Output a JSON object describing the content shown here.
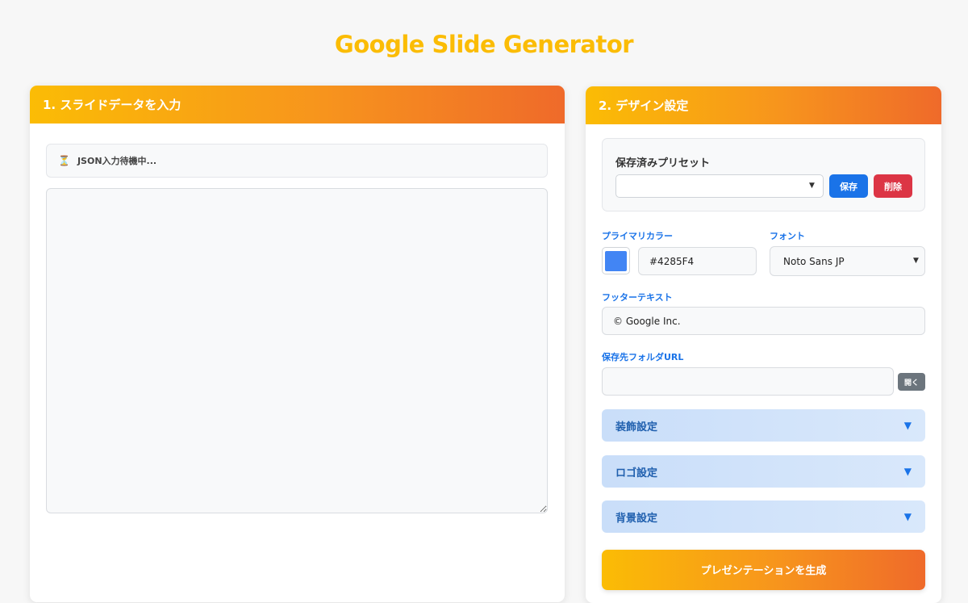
{
  "page": {
    "title": "Google Slide Generator"
  },
  "input_panel": {
    "header": "1. スライドデータを入力",
    "status_icon": "hourglass-icon",
    "status_text": "JSON入力待機中...",
    "textarea_value": ""
  },
  "design_panel": {
    "header": "2. デザイン設定",
    "presets": {
      "label": "保存済みプリセット",
      "selected": "",
      "save_label": "保存",
      "delete_label": "削除"
    },
    "primary_color": {
      "label": "プライマリカラー",
      "value": "#4285F4",
      "swatch": "#4285F4"
    },
    "font": {
      "label": "フォント",
      "selected": "Noto Sans JP"
    },
    "footer_text": {
      "label": "フッターテキスト",
      "value": "© Google Inc."
    },
    "folder_url": {
      "label": "保存先フォルダURL",
      "value": "",
      "open_label": "開く"
    },
    "sections": [
      {
        "label": "装飾設定",
        "icon": "triangle-down-icon"
      },
      {
        "label": "ロゴ設定",
        "icon": "triangle-down-icon"
      },
      {
        "label": "背景設定",
        "icon": "triangle-down-icon"
      }
    ],
    "generate_label": "プレゼンテーションを生成"
  },
  "colors": {
    "title": "#fbbc05",
    "header_gradient_start": "#fbbc05",
    "header_gradient_end": "#ef6a2a",
    "accent_blue": "#1a73e8",
    "save_button": "#1a73e8",
    "delete_button": "#dc3545",
    "open_button": "#6c757d",
    "accordion_bg": "#c9def9"
  }
}
